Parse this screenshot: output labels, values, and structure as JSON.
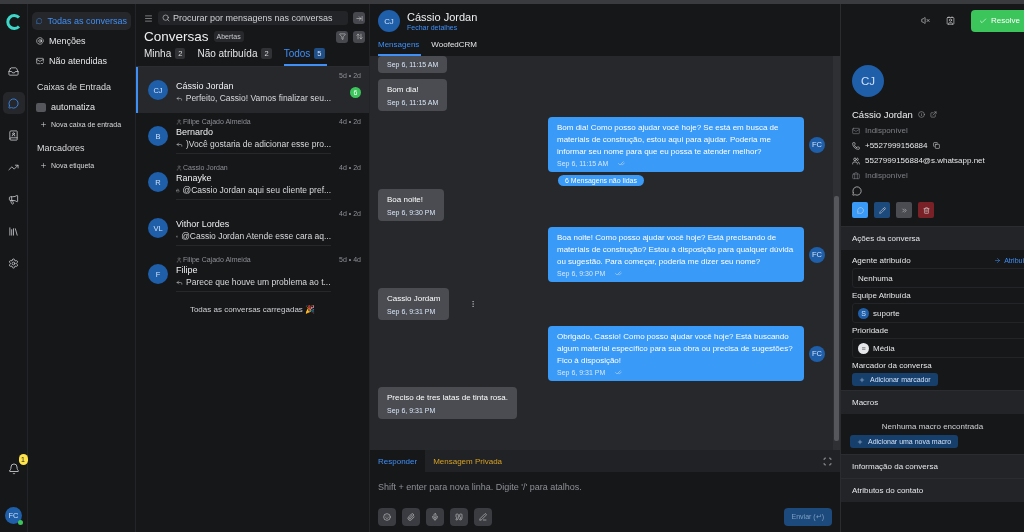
{
  "nav_rail": [
    {
      "selected": false
    },
    {
      "selected": true
    },
    {
      "selected": false
    },
    {
      "selected": false
    },
    {
      "selected": false
    },
    {
      "selected": false
    },
    {
      "selected": false
    }
  ],
  "notifications": {
    "count": "1"
  },
  "user": {
    "initials": "FC",
    "online": true
  },
  "sidebar": {
    "items": [
      {
        "label": "Todas as conversas",
        "selected": true
      },
      {
        "label": "Menções",
        "selected": false
      },
      {
        "label": "Não atendidas",
        "selected": false
      }
    ],
    "sections": [
      {
        "title": "Caixas de Entrada",
        "items": [
          {
            "label": "automatiza"
          }
        ],
        "add_label": "Nova caixa de entrada"
      },
      {
        "title": "Marcadores",
        "add_label": "Nova etiqueta"
      }
    ]
  },
  "conversation_list": {
    "search_placeholder": "Procurar por mensagens nas conversas",
    "title": "Conversas",
    "status": "Abertas",
    "tabs": [
      {
        "label": "Minha",
        "count": "2",
        "selected": false
      },
      {
        "label": "Não atribuída",
        "count": "2",
        "selected": false
      },
      {
        "label": "Todos",
        "count": "5",
        "selected": true
      }
    ],
    "conversations": [
      {
        "initials": "CJ",
        "name": "Cássio Jordan",
        "preview": "Perfeito, Cassio! Vamos finalizar seu...",
        "kind": "reply",
        "time": "5d • 2d",
        "unread": "6",
        "selected": true
      },
      {
        "initials": "B",
        "agent": "Filipe Cajado Almeida",
        "name": "Bernardo",
        "preview": ")Você gostaria de adicionar esse pro...",
        "kind": "reply",
        "time": "4d • 2d",
        "selected": false
      },
      {
        "initials": "R",
        "agent": "Cassio Jordan",
        "name": "Ranayke",
        "preview": "@Cassio Jordan aqui seu cliente pref...",
        "kind": "private",
        "time": "4d • 2d",
        "selected": false
      },
      {
        "initials": "VL",
        "name": "Vithor Lordes",
        "preview": "@Cassio Jordan Atende esse cara aq...",
        "kind": "private",
        "time": "4d • 2d",
        "selected": false
      },
      {
        "initials": "F",
        "agent": "Filipe Cajado Almeida",
        "name": "Filipe",
        "preview": "Parece que houve um problema ao t...",
        "kind": "reply",
        "time": "5d • 4d",
        "selected": false
      }
    ],
    "footer": "Todas as conversas carregadas 🎉"
  },
  "chat": {
    "initials": "CJ",
    "name": "Cássio Jordan",
    "close_link": "Fechar detalhes",
    "tabs": [
      {
        "label": "Mensagens",
        "selected": true
      },
      {
        "label": "WoofedCRM",
        "selected": false
      }
    ],
    "messages": [
      {
        "kind": "incoming",
        "time": "Sep 6, 11:15 AM"
      },
      {
        "kind": "incoming",
        "text": "Bom dia!",
        "time": "Sep 6, 11:15 AM"
      },
      {
        "kind": "outgoing",
        "text": "Bom dia! Como posso ajudar você hoje? Se está em busca de materiais de construção, estou aqui para ajudar. Poderia me informar seu nome para que eu possa te atender melhor?",
        "time": "Sep 6, 11:15 AM",
        "initials": "FC"
      },
      {
        "kind": "notice",
        "text": "6 Mensagens não lidas"
      },
      {
        "kind": "incoming",
        "text": "Boa noite!",
        "time": "Sep 6, 9:30 PM"
      },
      {
        "kind": "outgoing",
        "text": "Boa noite! Como posso ajudar você hoje? Está precisando de materiais de construção? Estou à disposição para qualquer dúvida ou sugestão. Para começar, poderia me dizer seu nome?",
        "time": "Sep 6, 9:30 PM",
        "initials": "FC"
      },
      {
        "kind": "incoming",
        "text": "Cassio Jordam",
        "time": "Sep 6, 9:31 PM"
      },
      {
        "kind": "outgoing",
        "text": "Obrigado, Cassio! Como posso ajudar você hoje? Está buscando algum material específico para sua obra ou precisa de sugestões? Fico à disposição!",
        "time": "Sep 6, 9:31 PM",
        "initials": "FC"
      },
      {
        "kind": "incoming",
        "text": "Preciso de tres latas de tinta rosa.",
        "time": "Sep 6, 9:31 PM"
      }
    ],
    "composer": {
      "tabs": [
        {
          "label": "Responder",
          "selected": true
        },
        {
          "label": "Mensagem Privada",
          "selected": false
        }
      ],
      "placeholder": "Shift + enter para nova linha. Digite '/' para atalhos.",
      "send": "Enviar (↵)"
    }
  },
  "details": {
    "resolve": "Resolve",
    "contact": {
      "initials": "CJ",
      "name": "Cássio Jordan",
      "email": "Indisponível",
      "phone": "+5527999156884",
      "identifier": "5527999156884@s.whatsapp.net",
      "company": "Indisponível"
    },
    "actions_title": "Ações da conversa",
    "fields": [
      {
        "label": "Agente atribuído",
        "link": "Atribui",
        "value": "Nenhuma"
      },
      {
        "label": "Equipe Atribuída",
        "value": "suporte",
        "badge": "S"
      },
      {
        "label": "Prioridade",
        "value": "Média",
        "badge": "≡"
      }
    ],
    "labels_title": "Marcador da conversa",
    "add_label": "Adicionar marcador",
    "macros_title": "Macros",
    "macros_empty": "Nenhuma macro encontrada",
    "add_macro": "Adicionar uma nova macro",
    "more_sections": [
      "Informação da conversa",
      "Atributos do contato"
    ]
  }
}
